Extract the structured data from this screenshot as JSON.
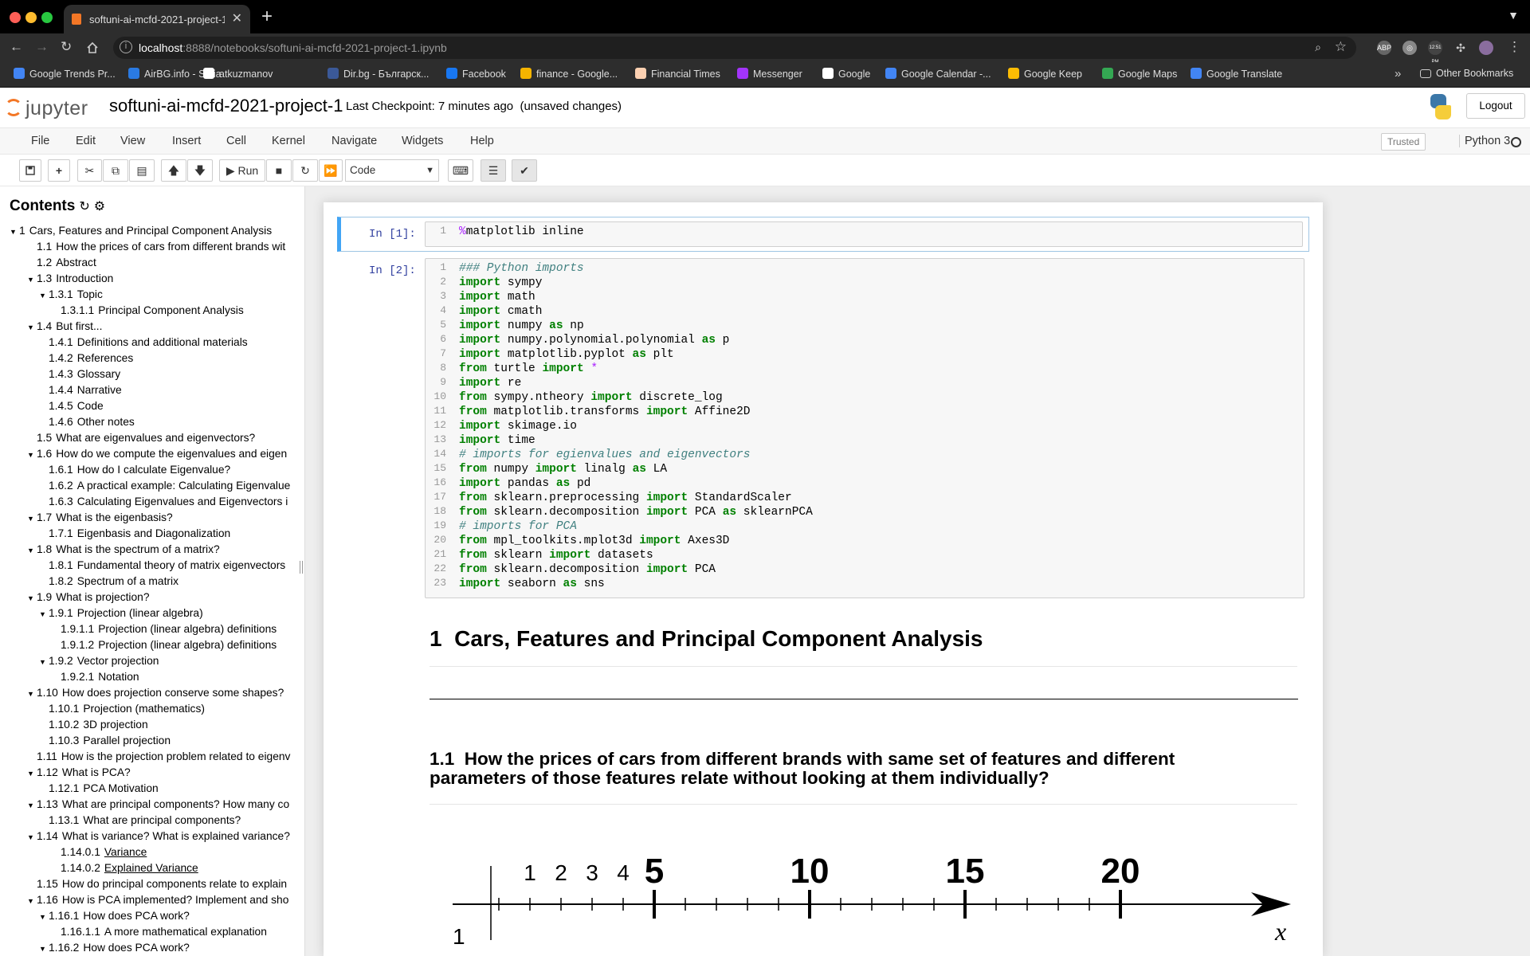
{
  "browser": {
    "tab_title": "softuni-ai-mcfd-2021-project-1",
    "url": "localhost:8888/notebooks/softuni-ai-mcfd-2021-project-1.ipynb",
    "url_host": "localhost",
    "url_rest": ":8888/notebooks/softuni-ai-mcfd-2021-project-1.ipynb",
    "clock_badge": "12:51 PM",
    "bookmarks": [
      {
        "label": "Google Trends Pr...",
        "color": "#4285f4"
      },
      {
        "label": "AirBG.info - Sofia",
        "color": "#2a7ae2"
      },
      {
        "label": "atkuzmanov",
        "color": "#ffffff"
      },
      {
        "label": "Dir.bg - Българск...",
        "color": "#3b5998"
      },
      {
        "label": "Facebook",
        "color": "#1877f2"
      },
      {
        "label": "finance - Google...",
        "color": "#f4b400"
      },
      {
        "label": "Financial Times",
        "color": "#fcd0b1"
      },
      {
        "label": "Messenger",
        "color": "#a334fa"
      },
      {
        "label": "Google",
        "color": "#ffffff"
      },
      {
        "label": "Google Calendar -...",
        "color": "#4285f4"
      },
      {
        "label": "Google Keep",
        "color": "#fbbc04"
      },
      {
        "label": "Google Maps",
        "color": "#34a853"
      },
      {
        "label": "Google Translate",
        "color": "#4285f4"
      }
    ],
    "more_chevron": "»",
    "other_bookmarks": "Other Bookmarks"
  },
  "jupyter": {
    "logo_text": "jupyter",
    "notebook_name": "softuni-ai-mcfd-2021-project-1",
    "checkpoint": "Last Checkpoint: 7 minutes ago",
    "unsaved": "(unsaved changes)",
    "logout": "Logout",
    "menu": [
      "File",
      "Edit",
      "View",
      "Insert",
      "Cell",
      "Kernel",
      "Navigate",
      "Widgets",
      "Help"
    ],
    "trusted": "Trusted",
    "kernel": "Python 3",
    "run_label": "Run",
    "cell_type": "Code"
  },
  "toc": {
    "title": "Contents",
    "items": [
      {
        "num": "1",
        "text": "Cars, Features and Principal Component Analysis",
        "level": 0,
        "caret": true
      },
      {
        "num": "1.1",
        "text": "How the prices of cars from different brands wit",
        "level": 1,
        "caret": false
      },
      {
        "num": "1.2",
        "text": "Abstract",
        "level": 1,
        "caret": false
      },
      {
        "num": "1.3",
        "text": "Introduction",
        "level": 1,
        "caret": true
      },
      {
        "num": "1.3.1",
        "text": "Topic",
        "level": 2,
        "caret": true
      },
      {
        "num": "1.3.1.1",
        "text": "Principal Component Analysis",
        "level": 3,
        "caret": false
      },
      {
        "num": "1.4",
        "text": "But first...",
        "level": 1,
        "caret": true
      },
      {
        "num": "1.4.1",
        "text": "Definitions and additional materials",
        "level": 2,
        "caret": false
      },
      {
        "num": "1.4.2",
        "text": "References",
        "level": 2,
        "caret": false
      },
      {
        "num": "1.4.3",
        "text": "Glossary",
        "level": 2,
        "caret": false
      },
      {
        "num": "1.4.4",
        "text": "Narrative",
        "level": 2,
        "caret": false
      },
      {
        "num": "1.4.5",
        "text": "Code",
        "level": 2,
        "caret": false
      },
      {
        "num": "1.4.6",
        "text": "Other notes",
        "level": 2,
        "caret": false
      },
      {
        "num": "1.5",
        "text": "What are eigenvalues and eigenvectors?",
        "level": 1,
        "caret": false
      },
      {
        "num": "1.6",
        "text": "How do we compute the eigenvalues and eigen",
        "level": 1,
        "caret": true
      },
      {
        "num": "1.6.1",
        "text": "How do I calculate Eigenvalue?",
        "level": 2,
        "caret": false
      },
      {
        "num": "1.6.2",
        "text": "A practical example: Calculating Eigenvalue",
        "level": 2,
        "caret": false
      },
      {
        "num": "1.6.3",
        "text": "Calculating Eigenvalues and Eigenvectors i",
        "level": 2,
        "caret": false
      },
      {
        "num": "1.7",
        "text": "What is the eigenbasis?",
        "level": 1,
        "caret": true
      },
      {
        "num": "1.7.1",
        "text": "Eigenbasis and Diagonalization",
        "level": 2,
        "caret": false
      },
      {
        "num": "1.8",
        "text": "What is the spectrum of a matrix?",
        "level": 1,
        "caret": true
      },
      {
        "num": "1.8.1",
        "text": "Fundamental theory of matrix eigenvectors",
        "level": 2,
        "caret": false
      },
      {
        "num": "1.8.2",
        "text": "Spectrum of a matrix",
        "level": 2,
        "caret": false
      },
      {
        "num": "1.9",
        "text": "What is projection?",
        "level": 1,
        "caret": true
      },
      {
        "num": "1.9.1",
        "text": "Projection (linear algebra)",
        "level": 2,
        "caret": true
      },
      {
        "num": "1.9.1.1",
        "text": "Projection (linear algebra) definitions",
        "level": 3,
        "caret": false
      },
      {
        "num": "1.9.1.2",
        "text": "Projection (linear algebra) definitions",
        "level": 3,
        "caret": false
      },
      {
        "num": "1.9.2",
        "text": "Vector projection",
        "level": 2,
        "caret": true
      },
      {
        "num": "1.9.2.1",
        "text": "Notation",
        "level": 3,
        "caret": false
      },
      {
        "num": "1.10",
        "text": "How does projection conserve some shapes?",
        "level": 1,
        "caret": true
      },
      {
        "num": "1.10.1",
        "text": "Projection (mathematics)",
        "level": 2,
        "caret": false
      },
      {
        "num": "1.10.2",
        "text": "3D projection",
        "level": 2,
        "caret": false
      },
      {
        "num": "1.10.3",
        "text": "Parallel projection",
        "level": 2,
        "caret": false
      },
      {
        "num": "1.11",
        "text": "How is the projection problem related to eigenv",
        "level": 1,
        "caret": false
      },
      {
        "num": "1.12",
        "text": "What is PCA?",
        "level": 1,
        "caret": true
      },
      {
        "num": "1.12.1",
        "text": "PCA Motivation",
        "level": 2,
        "caret": false
      },
      {
        "num": "1.13",
        "text": "What are principal components? How many co",
        "level": 1,
        "caret": true
      },
      {
        "num": "1.13.1",
        "text": "What are principal components?",
        "level": 2,
        "caret": false
      },
      {
        "num": "1.14",
        "text": "What is variance? What is explained variance?",
        "level": 1,
        "caret": true
      },
      {
        "num": "1.14.0.1",
        "text": "Variance",
        "level": 3,
        "caret": false,
        "underline": true
      },
      {
        "num": "1.14.0.2",
        "text": "Explained Variance",
        "level": 3,
        "caret": false,
        "underline": true
      },
      {
        "num": "1.15",
        "text": "How do principal components relate to explain",
        "level": 1,
        "caret": false
      },
      {
        "num": "1.16",
        "text": "How is PCA implemented? Implement and sho",
        "level": 1,
        "caret": true
      },
      {
        "num": "1.16.1",
        "text": "How does PCA work?",
        "level": 2,
        "caret": true
      },
      {
        "num": "1.16.1.1",
        "text": "A more mathematical explanation",
        "level": 3,
        "caret": false
      },
      {
        "num": "1.16.2",
        "text": "How does PCA work?",
        "level": 2,
        "caret": true
      }
    ]
  },
  "cells": {
    "cell1_prompt": "In [1]:",
    "cell2_prompt": "In [2]:",
    "cell1_lines": [
      [
        [
          "op",
          "%"
        ],
        [
          "",
          "matplotlib inline"
        ]
      ]
    ],
    "cell2_lines": [
      [
        [
          "cm",
          "### Python imports"
        ]
      ],
      [
        [
          "kw",
          "import"
        ],
        [
          "",
          " sympy"
        ]
      ],
      [
        [
          "kw",
          "import"
        ],
        [
          "",
          " math"
        ]
      ],
      [
        [
          "kw",
          "import"
        ],
        [
          "",
          " cmath"
        ]
      ],
      [
        [
          "kw",
          "import"
        ],
        [
          "",
          " numpy "
        ],
        [
          "kw",
          "as"
        ],
        [
          "",
          " np"
        ]
      ],
      [
        [
          "kw",
          "import"
        ],
        [
          "",
          " numpy.polynomial.polynomial "
        ],
        [
          "kw",
          "as"
        ],
        [
          "",
          " p"
        ]
      ],
      [
        [
          "kw",
          "import"
        ],
        [
          "",
          " matplotlib.pyplot "
        ],
        [
          "kw",
          "as"
        ],
        [
          "",
          " plt"
        ]
      ],
      [
        [
          "kw",
          "from"
        ],
        [
          "",
          " turtle "
        ],
        [
          "kw",
          "import"
        ],
        [
          "",
          " "
        ],
        [
          "op",
          "*"
        ]
      ],
      [
        [
          "kw",
          "import"
        ],
        [
          "",
          " re"
        ]
      ],
      [
        [
          "kw",
          "from"
        ],
        [
          "",
          " sympy.ntheory "
        ],
        [
          "kw",
          "import"
        ],
        [
          "",
          " discrete_log"
        ]
      ],
      [
        [
          "kw",
          "from"
        ],
        [
          "",
          " matplotlib.transforms "
        ],
        [
          "kw",
          "import"
        ],
        [
          "",
          " Affine2D"
        ]
      ],
      [
        [
          "kw",
          "import"
        ],
        [
          "",
          " skimage.io"
        ]
      ],
      [
        [
          "kw",
          "import"
        ],
        [
          "",
          " time"
        ]
      ],
      [
        [
          "cm",
          "# imports for egienvalues and eigenvectors"
        ]
      ],
      [
        [
          "kw",
          "from"
        ],
        [
          "",
          " numpy "
        ],
        [
          "kw",
          "import"
        ],
        [
          "",
          " linalg "
        ],
        [
          "kw",
          "as"
        ],
        [
          "",
          " LA"
        ]
      ],
      [
        [
          "kw",
          "import"
        ],
        [
          "",
          " pandas "
        ],
        [
          "kw",
          "as"
        ],
        [
          "",
          " pd"
        ]
      ],
      [
        [
          "kw",
          "from"
        ],
        [
          "",
          " sklearn.preprocessing "
        ],
        [
          "kw",
          "import"
        ],
        [
          "",
          " StandardScaler"
        ]
      ],
      [
        [
          "kw",
          "from"
        ],
        [
          "",
          " sklearn.decomposition "
        ],
        [
          "kw",
          "import"
        ],
        [
          "",
          " PCA "
        ],
        [
          "kw",
          "as"
        ],
        [
          "",
          " sklearnPCA"
        ]
      ],
      [
        [
          "cm",
          "# imports for PCA"
        ]
      ],
      [
        [
          "kw",
          "from"
        ],
        [
          "",
          " mpl_toolkits.mplot3d "
        ],
        [
          "kw",
          "import"
        ],
        [
          "",
          " Axes3D"
        ]
      ],
      [
        [
          "kw",
          "from"
        ],
        [
          "",
          " sklearn "
        ],
        [
          "kw",
          "import"
        ],
        [
          "",
          " datasets"
        ]
      ],
      [
        [
          "kw",
          "from"
        ],
        [
          "",
          " sklearn.decomposition "
        ],
        [
          "kw",
          "import"
        ],
        [
          "",
          " PCA"
        ]
      ],
      [
        [
          "kw",
          "import"
        ],
        [
          "",
          " seaborn "
        ],
        [
          "kw",
          "as"
        ],
        [
          "",
          " sns"
        ]
      ]
    ]
  },
  "markdown": {
    "h1_num": "1",
    "h1_text": "Cars, Features and Principal Component Analysis",
    "h2_num": "1.1",
    "h2_text": "How the prices of cars from different brands with same set of features and different parameters of those features relate without looking at them individually?"
  },
  "figure": {
    "small_labels": [
      "1",
      "2",
      "3",
      "4"
    ],
    "big_labels": [
      "5",
      "10",
      "15",
      "20"
    ],
    "axis_label": "x",
    "y_label": "1"
  }
}
